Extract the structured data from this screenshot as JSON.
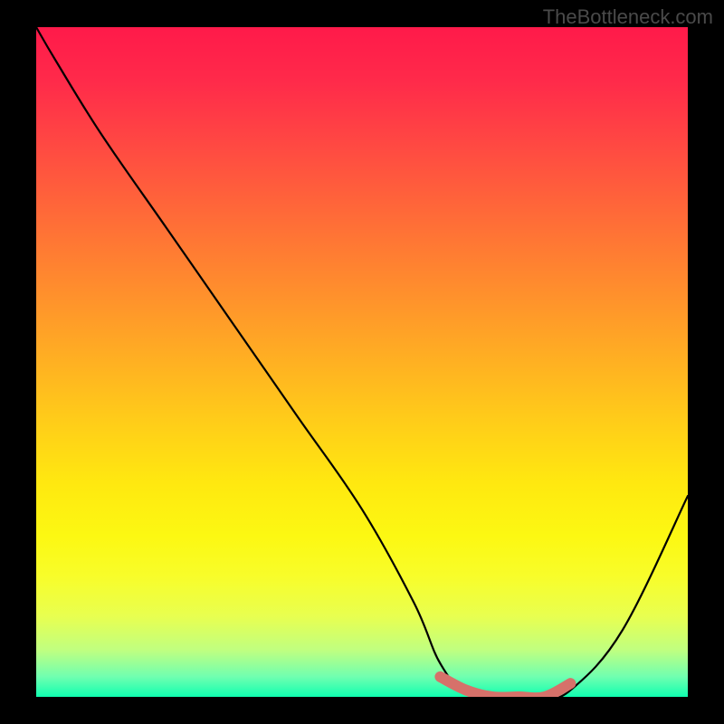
{
  "watermark": "TheBottleneck.com",
  "chart_data": {
    "type": "line",
    "title": "",
    "xlabel": "",
    "ylabel": "",
    "xlim": [
      0,
      100
    ],
    "ylim": [
      0,
      100
    ],
    "grid": false,
    "background_gradient": {
      "top": "#ff1a4a",
      "middle": "#ffea10",
      "bottom": "#10ffb0"
    },
    "series": [
      {
        "name": "bottleneck-curve",
        "color": "#000000",
        "x": [
          0,
          3,
          10,
          20,
          30,
          40,
          50,
          58,
          62,
          66,
          74,
          78,
          82,
          90,
          100
        ],
        "y": [
          100,
          95,
          84,
          70,
          56,
          42,
          28,
          14,
          5,
          1,
          0,
          0,
          1,
          10,
          30
        ]
      }
    ],
    "highlight_segment": {
      "name": "valley-highlight",
      "color": "#d6716a",
      "x_start": 62,
      "x_end": 82,
      "points": [
        {
          "x": 62,
          "y": 3
        },
        {
          "x": 66,
          "y": 1
        },
        {
          "x": 70,
          "y": 0
        },
        {
          "x": 74,
          "y": 0
        },
        {
          "x": 78,
          "y": 0
        },
        {
          "x": 82,
          "y": 2
        }
      ]
    }
  }
}
